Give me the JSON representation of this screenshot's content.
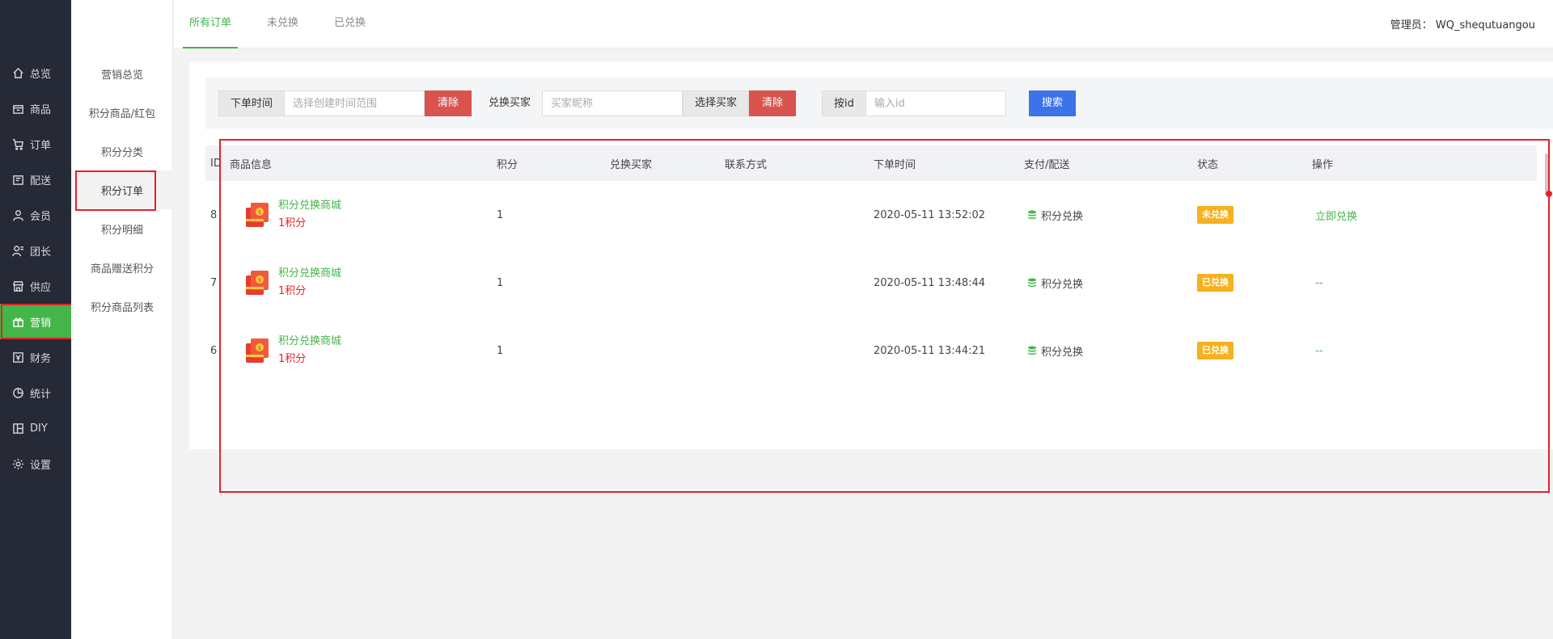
{
  "sidebar": {
    "items": [
      {
        "label": "总览",
        "icon": "home-icon"
      },
      {
        "label": "商品",
        "icon": "box-icon"
      },
      {
        "label": "订单",
        "icon": "cart-icon"
      },
      {
        "label": "配送",
        "icon": "delivery-icon"
      },
      {
        "label": "会员",
        "icon": "user-icon"
      },
      {
        "label": "团长",
        "icon": "leader-icon"
      },
      {
        "label": "供应",
        "icon": "store-icon"
      },
      {
        "label": "营销",
        "icon": "gift-icon",
        "active": true
      },
      {
        "label": "财务",
        "icon": "finance-icon"
      },
      {
        "label": "统计",
        "icon": "pie-chart-icon"
      },
      {
        "label": "DIY",
        "icon": "layout-icon"
      },
      {
        "label": "设置",
        "icon": "gear-icon"
      }
    ]
  },
  "subnav": {
    "items": [
      "营销总览",
      "积分商品/红包",
      "积分分类",
      "积分订单",
      "积分明细",
      "商品赠送积分",
      "积分商品列表"
    ],
    "active": "积分订单"
  },
  "topbar": {
    "tabs": [
      "所有订单",
      "未兑换",
      "已兑换"
    ],
    "active_tab": "所有订单",
    "admin_label": "管理员： WQ_shequtuangou"
  },
  "filters": {
    "time_label": "下单时间",
    "time_placeholder": "选择创建时间范围",
    "clear_label": "清除",
    "buyer_label": "兑换买家",
    "buyer_placeholder": "买家昵称",
    "select_buyer_label": "选择买家",
    "id_label": "按id",
    "id_placeholder": "输入id",
    "search_label": "搜索"
  },
  "table": {
    "headers": [
      "ID",
      "商品信息",
      "积分",
      "兑换买家",
      "联系方式",
      "下单时间",
      "支付/配送",
      "状态",
      "操作"
    ],
    "rows": [
      {
        "id": "8",
        "goods_name": "积分兑换商城",
        "goods_score": "1积分",
        "score": "1",
        "buyer": "",
        "contact": "",
        "time": "2020-05-11 13:52:02",
        "pay": "积分兑换",
        "status": "未兑换",
        "op": "立即兑换"
      },
      {
        "id": "7",
        "goods_name": "积分兑换商城",
        "goods_score": "1积分",
        "score": "1",
        "buyer": "",
        "contact": "",
        "time": "2020-05-11 13:48:44",
        "pay": "积分兑换",
        "status": "已兑换",
        "op": "--"
      },
      {
        "id": "6",
        "goods_name": "积分兑换商城",
        "goods_score": "1积分",
        "score": "1",
        "buyer": "",
        "contact": "",
        "time": "2020-05-11 13:44:21",
        "pay": "积分兑换",
        "status": "已兑换",
        "op": "--"
      }
    ]
  },
  "colors": {
    "accent_green": "#44b549",
    "sidebar_bg": "#262a37",
    "danger_red": "#d9534f",
    "search_blue": "#3b73e8",
    "badge_yellow": "#f5b120",
    "annotation_red": "#e8202a"
  }
}
